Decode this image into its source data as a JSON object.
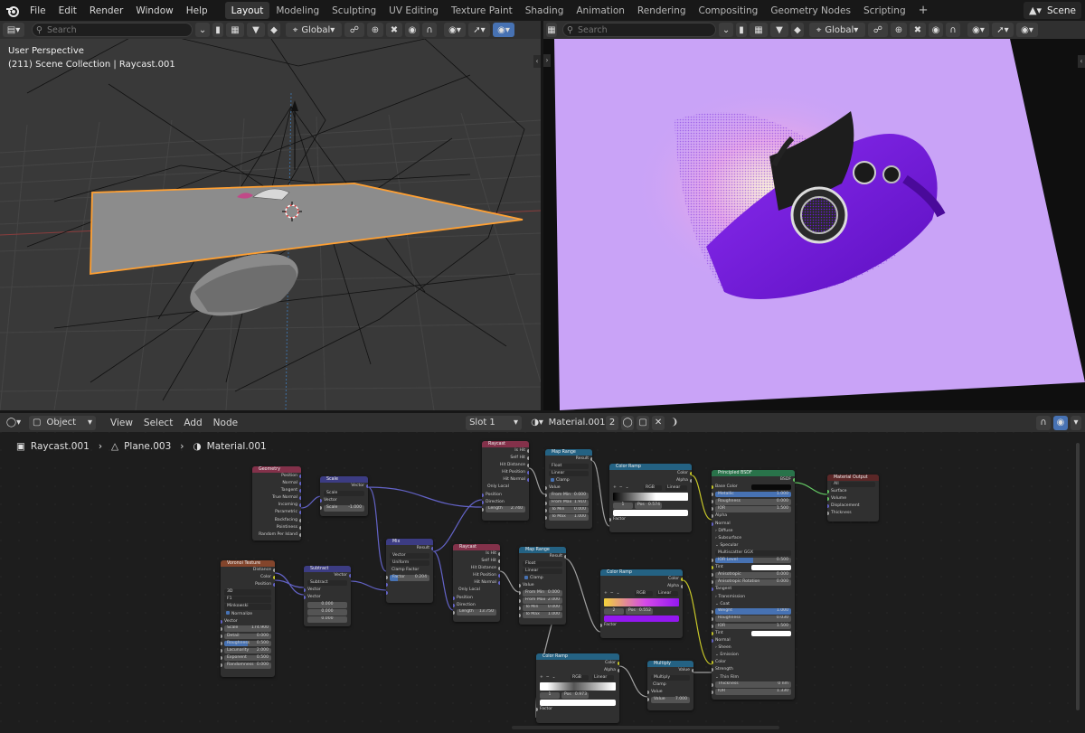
{
  "topbar": {
    "menus": [
      "File",
      "Edit",
      "Render",
      "Window",
      "Help"
    ],
    "workspaces": [
      "Layout",
      "Modeling",
      "Sculpting",
      "UV Editing",
      "Texture Paint",
      "Shading",
      "Animation",
      "Rendering",
      "Compositing",
      "Geometry Nodes",
      "Scripting"
    ],
    "active_workspace": "Layout",
    "add_tab": "+",
    "scene": "Scene"
  },
  "viewport_left": {
    "search_placeholder": "Search",
    "orientation": "Global",
    "title": "User Perspective",
    "subtitle": "(211) Scene Collection | Raycast.001"
  },
  "viewport_right": {
    "search_placeholder": "Search",
    "orientation": "Global",
    "background": "#c9a3f7"
  },
  "node_editor": {
    "mode": "Object",
    "menus": [
      "View",
      "Select",
      "Add",
      "Node"
    ],
    "slot": "Slot 1",
    "material": "Material.001",
    "users": "2",
    "breadcrumb": [
      "Raycast.001",
      "Plane.003",
      "Material.001"
    ]
  },
  "nodes": {
    "geometry": {
      "title": "Geometry",
      "outputs": [
        "Position",
        "Normal",
        "Tangent",
        "True Normal",
        "Incoming",
        "Parametric",
        "Backfacing",
        "Pointiness",
        "Random Per Island"
      ]
    },
    "scale": {
      "title": "Scale",
      "output": "Vector",
      "mode": "Scale",
      "input": "Vector",
      "scale_label": "Scale",
      "scale_value": "-1.000"
    },
    "voronoi": {
      "title": "Voronoi Texture",
      "outputs": [
        "Distance",
        "Color",
        "Position"
      ],
      "dims": "3D",
      "feature": "F1",
      "metric": "Minkowski",
      "normalize": "Normalize",
      "input": "Vector",
      "fields": [
        [
          "Scale",
          "174.900"
        ],
        [
          "Detail",
          "0.000"
        ],
        [
          "Roughness",
          "0.500"
        ],
        [
          "Lacunarity",
          "2.000"
        ],
        [
          "Exponent",
          "0.500"
        ],
        [
          "Randomness",
          "0.000"
        ]
      ]
    },
    "subtract": {
      "title": "Subtract",
      "output": "Vector",
      "mode": "Subtract",
      "inputs": [
        "Vector",
        "Vector"
      ],
      "values": [
        "0.000",
        "0.000",
        "0.000"
      ]
    },
    "mix": {
      "title": "Mix",
      "output": "Result",
      "type": "Vector",
      "blend": "Uniform",
      "clamp": "Clamp Factor",
      "factor_label": "Factor",
      "factor_value": "0.204"
    },
    "raycast1": {
      "title": "Raycast",
      "outputs": [
        "Is Hit",
        "Self Hit",
        "Hit Distance",
        "Hit Position",
        "Hit Normal"
      ],
      "only_local": "Only Local",
      "inputs": [
        "Position",
        "Direction"
      ],
      "length_label": "Length",
      "length_value": "2.740"
    },
    "raycast2": {
      "title": "Raycast",
      "outputs": [
        "Is Hit",
        "Self Hit",
        "Hit Distance",
        "Hit Position",
        "Hit Normal"
      ],
      "only_local": "Only Local",
      "inputs": [
        "Position",
        "Direction"
      ],
      "length_label": "Length",
      "length_value": "13.750"
    },
    "maprange1": {
      "title": "Map Range",
      "output": "Result",
      "type": "Float",
      "interp": "Linear",
      "clamp": "Clamp",
      "input": "Value",
      "fields": [
        [
          "From Min",
          "0.000"
        ],
        [
          "From Max",
          "1.910"
        ],
        [
          "To Min",
          "0.000"
        ],
        [
          "To Max",
          "1.000"
        ]
      ]
    },
    "maprange2": {
      "title": "Map Range",
      "output": "Result",
      "type": "Float",
      "interp": "Linear",
      "clamp": "Clamp",
      "input": "Value",
      "fields": [
        [
          "From Min",
          "0.000"
        ],
        [
          "From Max",
          "2.000"
        ],
        [
          "To Min",
          "0.000"
        ],
        [
          "To Max",
          "1.000"
        ]
      ]
    },
    "colorramp1": {
      "title": "Color Ramp",
      "outputs": [
        "Color",
        "Alpha"
      ],
      "mode": "RGB",
      "interp": "Linear",
      "index": "1",
      "pos_label": "Pos",
      "pos_value": "0.574",
      "input": "Factor"
    },
    "colorramp2": {
      "title": "Color Ramp",
      "outputs": [
        "Color",
        "Alpha"
      ],
      "mode": "RGB",
      "interp": "Linear",
      "index": "2",
      "pos_label": "Pos",
      "pos_value": "0.552",
      "input": "Factor"
    },
    "colorramp3": {
      "title": "Color Ramp",
      "outputs": [
        "Color",
        "Alpha"
      ],
      "mode": "RGB",
      "interp": "Linear",
      "index": "1",
      "pos_label": "Pos",
      "pos_value": "0.973",
      "input": "Factor"
    },
    "multiply": {
      "title": "Multiply",
      "output": "Value",
      "mode": "Multiply",
      "clamp": "Clamp",
      "input": "Value",
      "value_label": "Value",
      "value_value": "7.000"
    },
    "bsdf": {
      "title": "Principled BSDF",
      "output": "BSDF",
      "rows": [
        [
          "Base Color",
          ""
        ],
        [
          "Metallic",
          "1.000"
        ],
        [
          "Roughness",
          "0.000"
        ],
        [
          "IOR",
          "1.500"
        ],
        [
          "Alpha",
          ""
        ],
        [
          "Normal",
          ""
        ],
        [
          "Diffuse",
          ""
        ],
        [
          "Subsurface",
          ""
        ],
        [
          "Specular",
          ""
        ],
        [
          "Multiscatter GGX",
          ""
        ],
        [
          "IOR Level",
          "0.500"
        ],
        [
          "Tint",
          ""
        ],
        [
          "Anisotropic",
          "0.000"
        ],
        [
          "Anisotropic Rotation",
          "0.000"
        ],
        [
          "Tangent",
          ""
        ],
        [
          "Transmission",
          ""
        ],
        [
          "Coat",
          ""
        ],
        [
          "Weight",
          "1.000"
        ],
        [
          "Roughness",
          "0.030"
        ],
        [
          "IOR",
          "1.500"
        ],
        [
          "Tint",
          ""
        ],
        [
          "Normal",
          ""
        ],
        [
          "Sheen",
          ""
        ],
        [
          "Emission",
          ""
        ],
        [
          "Color",
          ""
        ],
        [
          "Strength",
          ""
        ],
        [
          "Thin Film",
          ""
        ],
        [
          "Thickness",
          "0 nm"
        ],
        [
          "IOR",
          "1.330"
        ]
      ]
    },
    "output": {
      "title": "Material Output",
      "target": "All",
      "inputs": [
        "Surface",
        "Volume",
        "Displacement",
        "Thickness"
      ]
    }
  },
  "colors": {
    "accent": "#4772b3",
    "selection_orange": "#ffa033",
    "node_input_header": "#83314a",
    "node_vector_header": "#3c3c83",
    "node_converter_header": "#246283",
    "node_texture_header": "#83452c",
    "node_shader_header": "#29734a",
    "node_output_header": "#5b2727"
  }
}
